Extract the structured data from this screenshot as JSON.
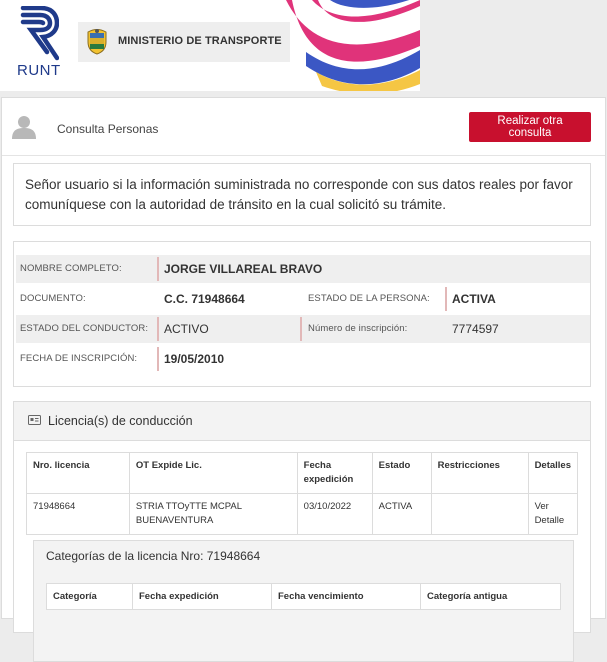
{
  "header": {
    "runt_logo_text": "RUNT",
    "ministry_label": "MINISTERIO DE TRANSPORTE",
    "colors": {
      "runt_blue": "#1f3a8a",
      "wave_pink": "#e0337a",
      "wave_blue": "#3b57c4",
      "wave_yellow": "#f5c644"
    }
  },
  "panel": {
    "title": "Consulta Personas",
    "action_button": "Realizar otra consulta",
    "accent_color": "#c8102e"
  },
  "notice": {
    "text": "Señor usuario si la información suministrada no corresponde con sus datos reales por favor comuníquese con la autoridad de tránsito en la cual solicitó su trámite."
  },
  "person": {
    "nombre_label": "NOMBRE COMPLETO:",
    "nombre_value": "JORGE VILLAREAL BRAVO",
    "documento_label": "DOCUMENTO:",
    "documento_value": "C.C. 71948664",
    "estado_persona_label": "ESTADO DE LA PERSONA:",
    "estado_persona_value": "ACTIVA",
    "estado_conductor_label": "ESTADO DEL CONDUCTOR:",
    "estado_conductor_value": "ACTIVO",
    "inscripcion_num_label": "Número de inscripción:",
    "inscripcion_num_value": "7774597",
    "fecha_inscripcion_label": "FECHA DE INSCRIPCIÓN:",
    "fecha_inscripcion_value": "19/05/2010"
  },
  "licencias": {
    "title": "Licencia(s) de conducción",
    "columns": [
      "Nro. licencia",
      "OT Expide Lic.",
      "Fecha expedición",
      "Estado",
      "Restricciones",
      "Detalles"
    ],
    "rows": [
      {
        "nro": "71948664",
        "ot": "STRIA TTOyTTE MCPAL BUENAVENTURA",
        "fecha": "03/10/2022",
        "estado": "ACTIVA",
        "restricciones": "",
        "detalles": "Ver Detalle"
      }
    ]
  },
  "categorias": {
    "title": "Categorías de la licencia Nro: 71948664",
    "columns": [
      "Categoría",
      "Fecha expedición",
      "Fecha vencimiento",
      "Categoría antigua"
    ]
  }
}
